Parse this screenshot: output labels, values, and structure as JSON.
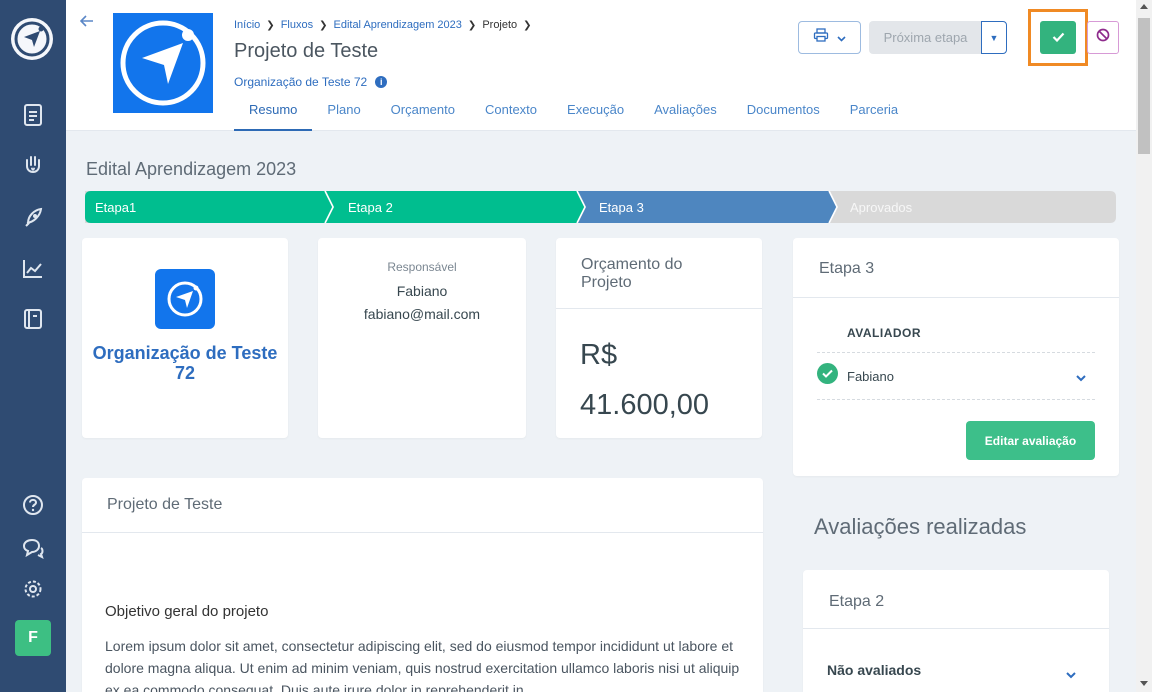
{
  "header": {
    "breadcrumb": [
      "Início",
      "Fluxos",
      "Edital Aprendizagem 2023",
      "Projeto"
    ],
    "title": "Projeto de Teste",
    "organization": "Organização de Teste 72",
    "next_step_label": "Próxima etapa",
    "tabs": [
      "Resumo",
      "Plano",
      "Orçamento",
      "Contexto",
      "Execução",
      "Avaliações",
      "Documentos",
      "Parceria"
    ],
    "active_tab": "Resumo"
  },
  "sidebar": {
    "icons": [
      "logo-icon",
      "document-icon",
      "hand-heart-icon",
      "rocket-icon",
      "chart-icon",
      "book-icon",
      "help-icon",
      "chat-icon",
      "settings-icon"
    ],
    "avatar_letter": "F"
  },
  "edital": {
    "title": "Edital Aprendizagem 2023",
    "stages": [
      {
        "label": "Etapa1",
        "status": "done"
      },
      {
        "label": "Etapa 2",
        "status": "done"
      },
      {
        "label": "Etapa 3",
        "status": "current"
      },
      {
        "label": "Aprovados",
        "status": "pending"
      }
    ]
  },
  "org_card": {
    "name": "Organização de Teste 72"
  },
  "responsible": {
    "label": "Responsável",
    "name": "Fabiano",
    "email": "fabiano@mail.com"
  },
  "budget": {
    "title": "Orçamento do Projeto",
    "value": "R$ 41.600,00"
  },
  "stage_card": {
    "title": "Etapa 3",
    "evaluator_header": "AVALIADOR",
    "evaluator": "Fabiano",
    "edit_button": "Editar avaliação"
  },
  "description": {
    "title": "Projeto de Teste",
    "objective_title": "Objetivo geral do projeto",
    "objective_text": "Lorem ipsum dolor sit amet, consectetur adipiscing elit, sed do eiusmod tempor incididunt ut labore et dolore magna aliqua. Ut enim ad minim veniam, quis nostrud exercitation ullamco laboris nisi ut aliquip ex ea commodo consequat. Duis aute irure dolor in reprehenderit in"
  },
  "evaluations": {
    "title": "Avaliações realizadas",
    "stage_title": "Etapa 2",
    "not_evaluated_label": "Não avaliados"
  },
  "colors": {
    "sidebar": "#2f4b72",
    "stage_done": "#00be8f",
    "stage_current": "#4e86bf",
    "stage_pending": "#d9d9d9",
    "accent": "#2e6dbf",
    "approve": "#33b37e",
    "highlight": "#f08a24"
  }
}
